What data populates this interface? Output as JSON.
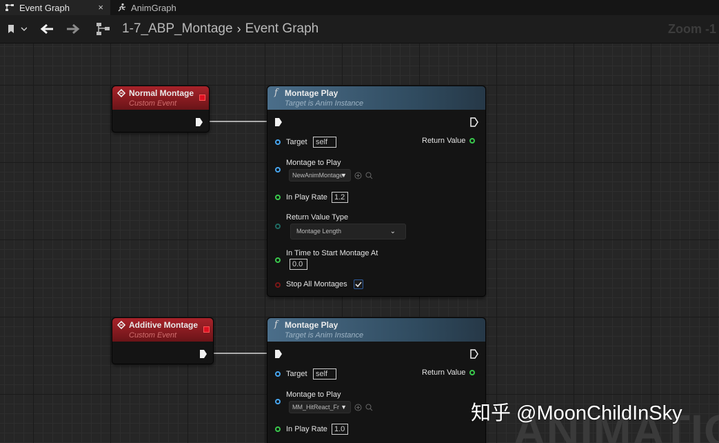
{
  "tabs": {
    "event_graph": "Event Graph",
    "close": "×",
    "anim_graph": "AnimGraph"
  },
  "toolbar": {
    "breadcrumb_asset": "1-7_ABP_Montage",
    "breadcrumb_sep": "›",
    "breadcrumb_graph": "Event Graph",
    "zoom": "Zoom -1"
  },
  "nodes": {
    "event1": {
      "title": "Normal Montage",
      "subtitle": "Custom Event"
    },
    "func1": {
      "title": "Montage Play",
      "subtitle": "Target is Anim Instance",
      "f": "f",
      "target_label": "Target",
      "target_value": "self",
      "return_label": "Return Value",
      "montage_label": "Montage to Play",
      "montage_value": "NewAnimMontage",
      "rate_label": "In Play Rate",
      "rate_value": "1.2",
      "rvt_label": "Return Value Type",
      "rvt_value": "Montage Length",
      "start_label": "In Time to Start Montage At",
      "start_value": "0.0",
      "stop_label": "Stop All Montages"
    },
    "event2": {
      "title": "Additive Montage",
      "subtitle": "Custom Event"
    },
    "func2": {
      "title": "Montage Play",
      "subtitle": "Target is Anim Instance",
      "f": "f",
      "target_label": "Target",
      "target_value": "self",
      "return_label": "Return Value",
      "montage_label": "Montage to Play",
      "montage_value": "MM_HitReact_Fr",
      "rate_label": "In Play Rate",
      "rate_value": "1.0"
    }
  },
  "overlay": {
    "watermark": "ANIMATION",
    "credit": "知乎 @MoonChildInSky"
  },
  "colors": {
    "event_header": "#a8232a",
    "func_header": "#4b6e8a",
    "object_pin": "#47a5ee",
    "float_pin": "#39c94c",
    "bool_pin": "#7b1717"
  }
}
